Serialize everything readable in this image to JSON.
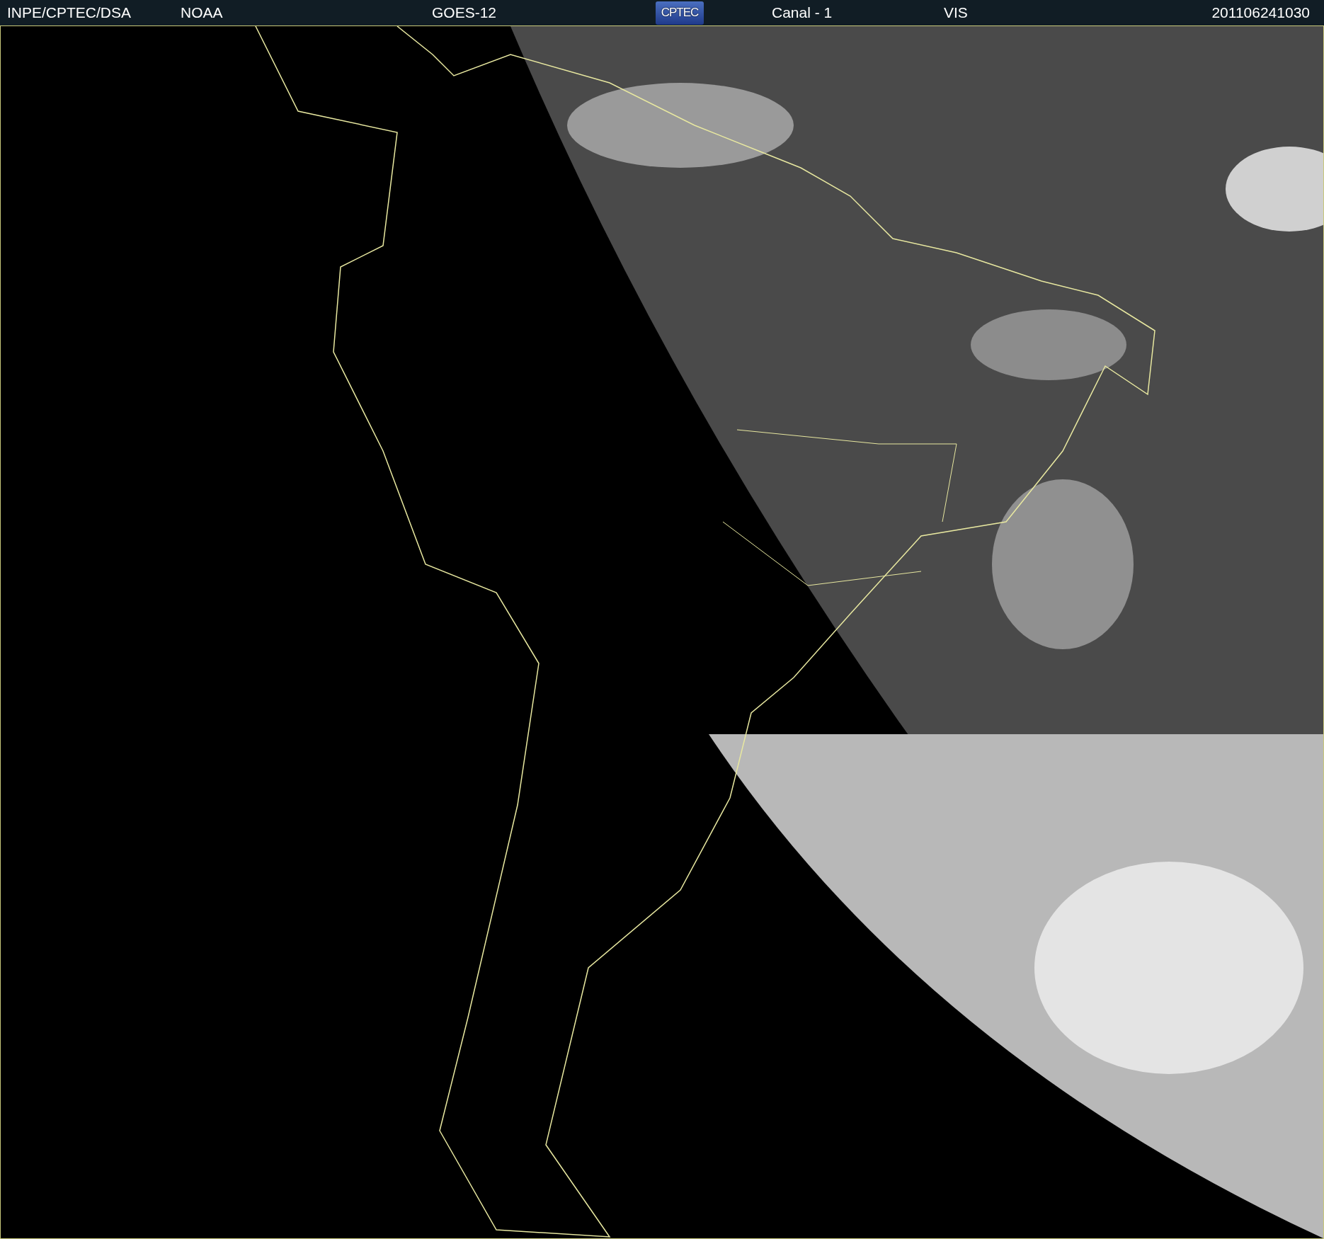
{
  "header": {
    "items": [
      {
        "kind": "text",
        "text": "INPE/CPTEC/DSA"
      },
      {
        "kind": "text",
        "text": "NOAA"
      },
      {
        "kind": "text",
        "text": "GOES-12"
      },
      {
        "kind": "logo",
        "text": "CPTEC"
      },
      {
        "kind": "text",
        "text": "Canal - 1"
      },
      {
        "kind": "text",
        "text": "VIS"
      },
      {
        "kind": "text",
        "text": "201106241030"
      }
    ]
  }
}
